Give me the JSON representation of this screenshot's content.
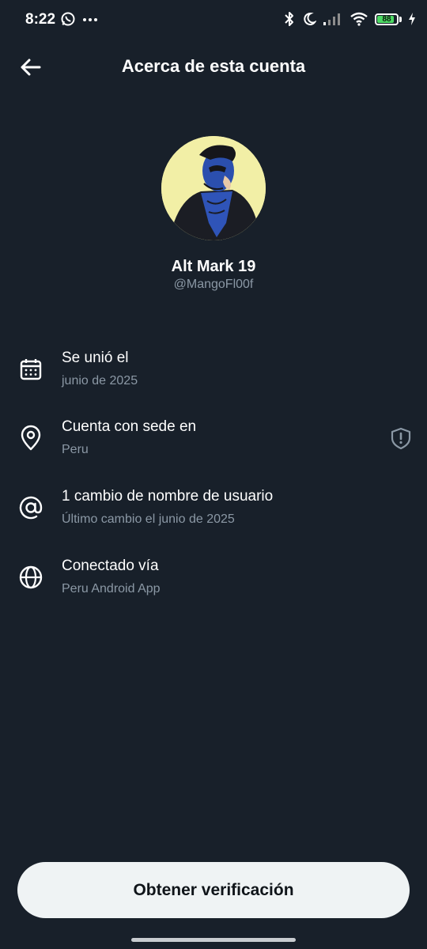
{
  "status_bar": {
    "time": "8:22",
    "left_icons": [
      "whatsapp-icon",
      "more-dots-icon"
    ],
    "right_icons": [
      "bluetooth-icon",
      "moon-icon",
      "signal-icon",
      "wifi-icon",
      "battery-icon",
      "charging-bolt-icon"
    ],
    "battery_level": "88",
    "battery_color": "#4cd964"
  },
  "header": {
    "title": "Acerca de esta cuenta",
    "back_icon": "arrow-left-icon"
  },
  "profile": {
    "display_name": "Alt Mark 19",
    "handle": "@MangoFl00f",
    "avatar_bg": "#f2efa6"
  },
  "info_rows": [
    {
      "icon": "calendar-icon",
      "title": "Se unió el",
      "subtitle": "junio de 2025"
    },
    {
      "icon": "location-pin-icon",
      "title": "Cuenta con sede en",
      "subtitle": "Peru",
      "trailing_icon": "shield-alert-icon"
    },
    {
      "icon": "at-sign-icon",
      "title": "1 cambio de nombre de usuario",
      "subtitle": "Último cambio el junio de 2025"
    },
    {
      "icon": "globe-icon",
      "title": "Conectado vía",
      "subtitle": "Peru Android App"
    }
  ],
  "cta": {
    "label": "Obtener verificación"
  },
  "colors": {
    "background": "#18202a",
    "secondary_text": "#8b98a5",
    "button_bg": "#eff3f4",
    "button_text": "#0f1419"
  }
}
